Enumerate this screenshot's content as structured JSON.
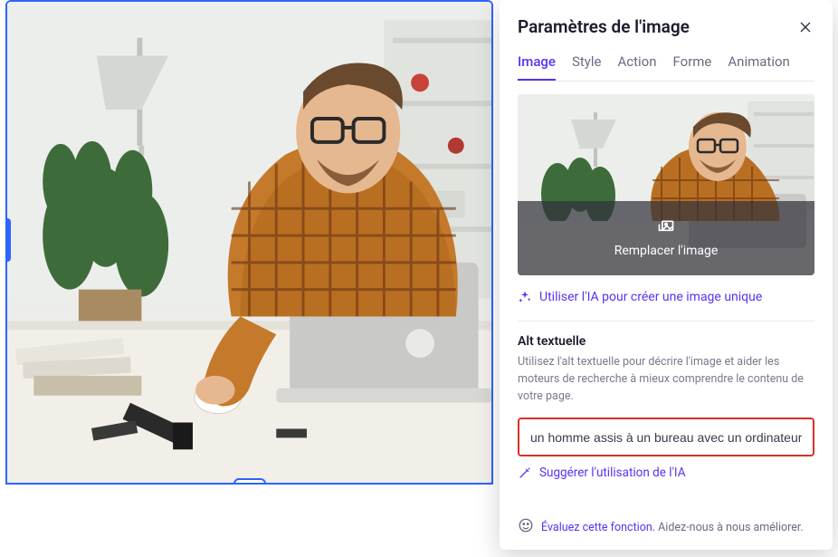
{
  "panel": {
    "title": "Paramètres de l'image",
    "tabs": [
      "Image",
      "Style",
      "Action",
      "Forme",
      "Animation"
    ],
    "active_tab": 0
  },
  "replace": {
    "label": "Remplacer l'image"
  },
  "ai_create": {
    "label": "Utiliser l'IA pour créer une image unique"
  },
  "alt": {
    "title": "Alt textuelle",
    "help": "Utilisez l'alt textuelle pour décrire l'image et aider les moteurs de recherche à mieux comprendre le contenu de votre page.",
    "value": "un homme assis à un bureau avec un ordinateur"
  },
  "ai_suggest": {
    "label": "Suggérer l'utilisation de l'IA"
  },
  "rate": {
    "link": "Évaluez cette fonction.",
    "tail": " Aidez-nous à nous améliorer."
  }
}
